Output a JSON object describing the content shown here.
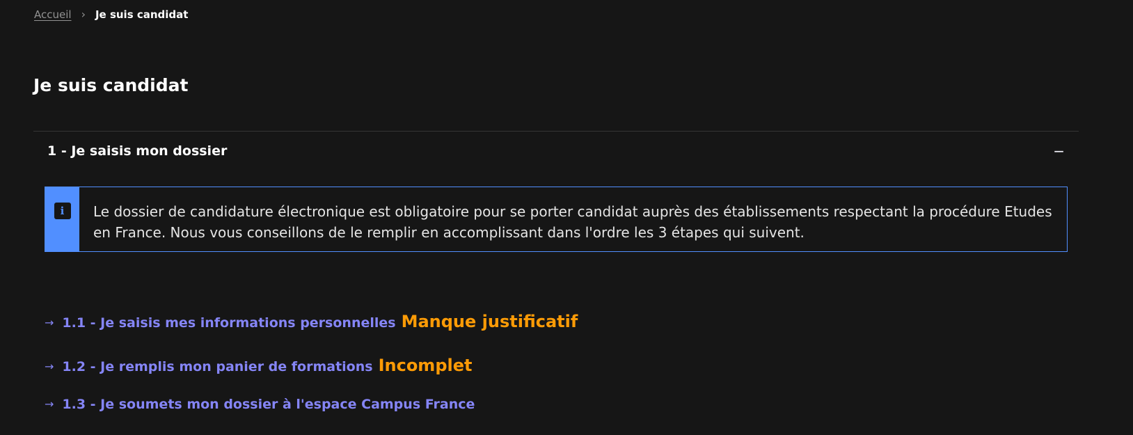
{
  "breadcrumb": {
    "home_label": "Accueil",
    "separator": "›",
    "current_label": "Je suis candidat"
  },
  "page": {
    "title": "Je suis candidat"
  },
  "accordion": {
    "title": "1 - Je saisis mon dossier",
    "toggle_symbol": "−",
    "expanded": true
  },
  "notice": {
    "icon": "info-icon",
    "icon_glyph": "i",
    "text": "Le dossier de candidature électronique est obligatoire pour se porter candidat auprès des établissements respectant la procédure Etudes en France. Nous vous conseillons de le remplir en accomplissant dans l'ordre les 3 étapes qui suivent."
  },
  "steps": [
    {
      "arrow": "→",
      "label": "1.1 - Je saisis mes informations personnelles",
      "status": "Manque justificatif"
    },
    {
      "arrow": "→",
      "label": "1.2 - Je remplis mon panier de formations",
      "status": "Incomplet"
    },
    {
      "arrow": "→",
      "label": "1.3 - Je soumets mon dossier à l'espace Campus France",
      "status": ""
    }
  ],
  "colors": {
    "background": "#161616",
    "link": "#8585f6",
    "status_warning": "#fc9b06",
    "info_accent": "#518fff"
  }
}
